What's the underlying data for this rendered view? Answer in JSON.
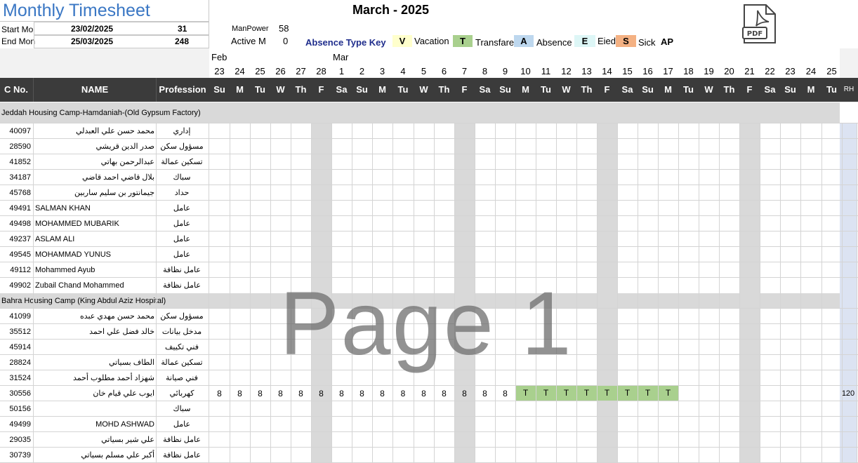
{
  "title": "Monthly Timesheet",
  "month_title": "March - 2025",
  "start": {
    "label": "Start Mo",
    "date": "23/02/2025",
    "num": "31"
  },
  "end": {
    "label": "End Mon",
    "date": "25/03/2025",
    "num": "248"
  },
  "manpower": {
    "label": "ManPower",
    "value": "58"
  },
  "active": {
    "label": "Active M",
    "value": "0"
  },
  "absence_key": {
    "title": "Absence Type Key",
    "items": [
      {
        "code": "V",
        "label": "Vacation",
        "color": "#ffffcc"
      },
      {
        "code": "T",
        "label": "Transfare",
        "color": "#a9d08e"
      },
      {
        "code": "A",
        "label": "Absence",
        "color": "#bdd7ee"
      },
      {
        "code": "E",
        "label": "Eied",
        "color": "#ddf6f6"
      },
      {
        "code": "S",
        "label": "Sick",
        "color": "#f4b183"
      },
      {
        "code": "AP",
        "label": "",
        "color": "#ffffff"
      }
    ]
  },
  "pdf_icon": "pdf-file-icon",
  "month_labels": {
    "feb": "Feb",
    "mar": "Mar"
  },
  "days": [
    {
      "n": "23",
      "d": "Su"
    },
    {
      "n": "24",
      "d": "M"
    },
    {
      "n": "25",
      "d": "Tu"
    },
    {
      "n": "26",
      "d": "W"
    },
    {
      "n": "27",
      "d": "Th"
    },
    {
      "n": "28",
      "d": "F"
    },
    {
      "n": "1",
      "d": "Sa"
    },
    {
      "n": "2",
      "d": "Su"
    },
    {
      "n": "3",
      "d": "M"
    },
    {
      "n": "4",
      "d": "Tu"
    },
    {
      "n": "5",
      "d": "W"
    },
    {
      "n": "6",
      "d": "Th"
    },
    {
      "n": "7",
      "d": "F"
    },
    {
      "n": "8",
      "d": "Sa"
    },
    {
      "n": "9",
      "d": "Su"
    },
    {
      "n": "10",
      "d": "M"
    },
    {
      "n": "11",
      "d": "Tu"
    },
    {
      "n": "12",
      "d": "W"
    },
    {
      "n": "13",
      "d": "Th"
    },
    {
      "n": "14",
      "d": "F"
    },
    {
      "n": "15",
      "d": "Sa"
    },
    {
      "n": "16",
      "d": "Su"
    },
    {
      "n": "17",
      "d": "M"
    },
    {
      "n": "18",
      "d": "Tu"
    },
    {
      "n": "19",
      "d": "W"
    },
    {
      "n": "20",
      "d": "Th"
    },
    {
      "n": "21",
      "d": "F"
    },
    {
      "n": "22",
      "d": "Sa"
    },
    {
      "n": "23",
      "d": "Su"
    },
    {
      "n": "24",
      "d": "M"
    },
    {
      "n": "25",
      "d": "Tu"
    }
  ],
  "columns": {
    "cno": "C No.",
    "name": "NAME",
    "profession": "Profession",
    "rh": "RH"
  },
  "sections": [
    {
      "title": "Jeddah Housing Camp-Hamdaniah-(Old Gypsum Factory)",
      "rows": [
        {
          "cno": "40097",
          "name": "محمد حسن علي العبدلي",
          "prof": "إداري",
          "rtl": true
        },
        {
          "cno": "28590",
          "name": "صدر الدين قريشي",
          "prof": "مسؤول سكن",
          "rtl": true
        },
        {
          "cno": "41852",
          "name": "عبدالرحمن بهاتي",
          "prof": "تسكين عمالة",
          "rtl": true
        },
        {
          "cno": "34187",
          "name": "بلال قاضي احمد قاضي",
          "prof": "سباك",
          "rtl": true
        },
        {
          "cno": "45768",
          "name": "جيمانتور بن سليم ساربين",
          "prof": "حداد",
          "rtl": true
        },
        {
          "cno": "49491",
          "name": "SALMAN KHAN",
          "prof": "عامل",
          "rtl": false
        },
        {
          "cno": "49498",
          "name": "MOHAMMED MUBARIK",
          "prof": "عامل",
          "rtl": false
        },
        {
          "cno": "49237",
          "name": "ASLAM ALI",
          "prof": "عامل",
          "rtl": false
        },
        {
          "cno": "49545",
          "name": "MOHAMMAD YUNUS",
          "prof": "عامل",
          "rtl": false
        },
        {
          "cno": "49112",
          "name": "Mohammed Ayub",
          "prof": "عامل نظافة",
          "rtl": false
        },
        {
          "cno": "49902",
          "name": "Zubail Chand Mohammed",
          "prof": "عامل نظافة",
          "rtl": false
        }
      ]
    },
    {
      "title": "Bahra Housing Camp (King Abdul Aziz Hospital)",
      "rows": [
        {
          "cno": "41099",
          "name": "محمد حسن مهدي عبده",
          "prof": "مسؤول سكن",
          "rtl": true
        },
        {
          "cno": "35512",
          "name": "خالد فضل علي احمد",
          "prof": "مدخل بيانات",
          "rtl": true
        },
        {
          "cno": "45914",
          "name": "",
          "prof": "فني تكييف",
          "rtl": true
        },
        {
          "cno": "28824",
          "name": "الطاف بسياتي",
          "prof": "تسكين عمالة",
          "rtl": true
        },
        {
          "cno": "31524",
          "name": "شهزاد أحمد مطلوب أحمد",
          "prof": "فني صيانة",
          "rtl": true
        },
        {
          "cno": "30556",
          "name": "ايوب علي قيام خان",
          "prof": "كهربائي",
          "rtl": true,
          "cells": [
            "8",
            "8",
            "8",
            "8",
            "8",
            "8",
            "8",
            "8",
            "8",
            "8",
            "8",
            "8",
            "8",
            "8",
            "8",
            "T",
            "T",
            "T",
            "T",
            "T",
            "T",
            "T",
            "T"
          ],
          "rh": "120"
        },
        {
          "cno": "50156",
          "name": "",
          "prof": "سباك",
          "rtl": true
        },
        {
          "cno": "49499",
          "name": "MOHD ASHWAD",
          "prof": "عامل",
          "rtl": "right"
        },
        {
          "cno": "29035",
          "name": "علي شير بسياتي",
          "prof": "عامل نظافة",
          "rtl": true
        },
        {
          "cno": "30739",
          "name": "أكبر علي مسلم بسياتي",
          "prof": "عامل نظافة",
          "rtl": true
        }
      ]
    }
  ],
  "watermark": "Page 1"
}
